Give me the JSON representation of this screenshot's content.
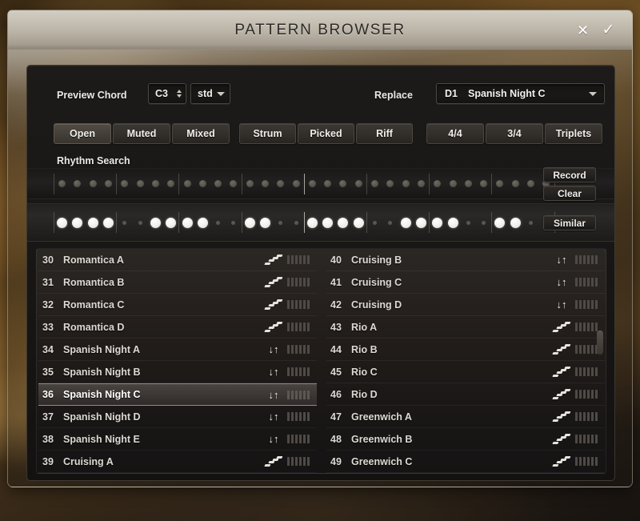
{
  "titlebar": {
    "title": "PATTERN BROWSER",
    "close_icon": "close-icon",
    "close_glyph": "✕",
    "confirm_icon": "check-icon",
    "confirm_glyph": "✓"
  },
  "controls": {
    "preview_chord_label": "Preview Chord",
    "chord_value": "C3",
    "chord_mode": "std",
    "chord_mode_options": [
      "std"
    ],
    "replace_label": "Replace",
    "replace_slot": "D1",
    "replace_name": "Spanish Night C",
    "replace_options": [
      "D1  Spanish Night C"
    ]
  },
  "button_groups": {
    "voicing": {
      "name": "voicing-group",
      "items": [
        "Open",
        "Muted",
        "Mixed"
      ],
      "selected": 0
    },
    "style": {
      "name": "style-group",
      "items": [
        "Strum",
        "Picked",
        "Riff"
      ],
      "selected": -1
    },
    "meter": {
      "name": "meter-group",
      "items": [
        "4/4",
        "3/4",
        "Triplets"
      ],
      "selected": -1
    }
  },
  "rhythm": {
    "search_label": "Rhythm Search",
    "record_label": "Record",
    "clear_label": "Clear",
    "similar_label": "Similar",
    "steps_total": 32,
    "steps_per_bar": 4,
    "search_steps": [
      "sm",
      "sm",
      "sm",
      "sm",
      "sm",
      "sm",
      "sm",
      "sm",
      "sm",
      "sm",
      "sm",
      "sm",
      "sm",
      "sm",
      "sm",
      "sm",
      "sm",
      "sm",
      "sm",
      "sm",
      "sm",
      "sm",
      "sm",
      "sm",
      "sm",
      "sm",
      "sm",
      "sm",
      "sm",
      "sm",
      "sm",
      "sm"
    ],
    "pattern_steps": [
      "on",
      "on",
      "on",
      "on",
      "off",
      "off",
      "on",
      "on",
      "on",
      "on",
      "off",
      "off",
      "on",
      "on",
      "off",
      "off",
      "on",
      "on",
      "on",
      "on",
      "off",
      "off",
      "on",
      "on",
      "on",
      "on",
      "off",
      "off",
      "on",
      "on",
      "off",
      "off"
    ]
  },
  "colors": {
    "accent_white": "#ffffff",
    "panel_dark": "#1a1716",
    "selected_row": "#3c3734",
    "text_primary": "#ddd9d3",
    "backdrop_amber": "#6d4e23"
  },
  "list": {
    "selected_index": 36,
    "left_column": [
      {
        "num": "30",
        "name": "Romantica A",
        "type": "picked",
        "meter": 6
      },
      {
        "num": "31",
        "name": "Romantica B",
        "type": "picked",
        "meter": 6
      },
      {
        "num": "32",
        "name": "Romantica C",
        "type": "picked",
        "meter": 6
      },
      {
        "num": "33",
        "name": "Romantica D",
        "type": "picked",
        "meter": 6
      },
      {
        "num": "34",
        "name": "Spanish Night A",
        "type": "strum",
        "meter": 6
      },
      {
        "num": "35",
        "name": "Spanish Night B",
        "type": "strum",
        "meter": 6
      },
      {
        "num": "36",
        "name": "Spanish Night C",
        "type": "strum",
        "meter": 6,
        "selected": true
      },
      {
        "num": "37",
        "name": "Spanish Night D",
        "type": "strum",
        "meter": 6
      },
      {
        "num": "38",
        "name": "Spanish Night E",
        "type": "strum",
        "meter": 6
      },
      {
        "num": "39",
        "name": "Cruising A",
        "type": "picked",
        "meter": 6
      }
    ],
    "right_column": [
      {
        "num": "40",
        "name": "Cruising B",
        "type": "strum",
        "meter": 6
      },
      {
        "num": "41",
        "name": "Cruising C",
        "type": "strum",
        "meter": 6
      },
      {
        "num": "42",
        "name": "Cruising D",
        "type": "strum",
        "meter": 6
      },
      {
        "num": "43",
        "name": "Rio A",
        "type": "picked",
        "meter": 6
      },
      {
        "num": "44",
        "name": "Rio B",
        "type": "picked",
        "meter": 6
      },
      {
        "num": "45",
        "name": "Rio C",
        "type": "picked",
        "meter": 6
      },
      {
        "num": "46",
        "name": "Rio D",
        "type": "picked",
        "meter": 6
      },
      {
        "num": "47",
        "name": "Greenwich A",
        "type": "picked",
        "meter": 6
      },
      {
        "num": "48",
        "name": "Greenwich B",
        "type": "picked",
        "meter": 6
      },
      {
        "num": "49",
        "name": "Greenwich C",
        "type": "picked",
        "meter": 6
      }
    ],
    "strum_glyph_down": "↓",
    "strum_glyph_up": "↑"
  }
}
